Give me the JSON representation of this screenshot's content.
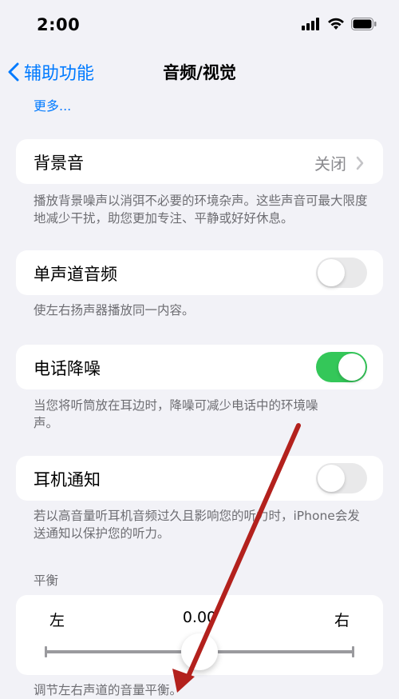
{
  "status_bar": {
    "time": "2:00"
  },
  "nav": {
    "back_label": "辅助功能",
    "title": "音频/视觉"
  },
  "more_link": "更多...",
  "background_sounds": {
    "label": "背景音",
    "value": "关闭",
    "footer": "播放背景噪声以消弭不必要的环境杂声。这些声音可最大限度地减少干扰，助您更加专注、平静或好好休息。"
  },
  "mono_audio": {
    "label": "单声道音频",
    "on": false,
    "footer": "使左右扬声器播放同一内容。"
  },
  "phone_noise_cancellation": {
    "label": "电话降噪",
    "on": true,
    "footer": "当您将听筒放在耳边时，降噪可减少电话中的环境噪声。"
  },
  "headphone_notifications": {
    "label": "耳机通知",
    "on": false,
    "footer": "若以高音量听耳机音频过久且影响您的听力时，iPhone会发送通知以保护您的听力。"
  },
  "balance": {
    "header": "平衡",
    "left_label": "左",
    "right_label": "右",
    "value_text": "0.00",
    "value": 0.0,
    "range": [
      -1,
      1
    ],
    "footer": "调节左右声道的音量平衡。"
  },
  "colors": {
    "accent": "#007aff",
    "toggle_on": "#34c759",
    "annotation_arrow": "#b3211d"
  }
}
